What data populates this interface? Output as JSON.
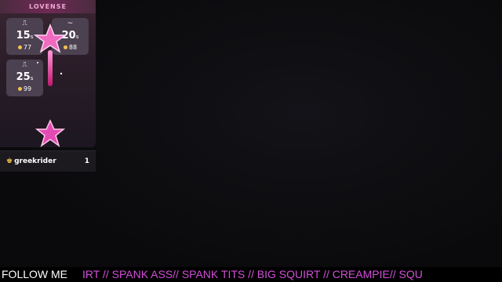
{
  "lovense": {
    "brand": "LOVENSE",
    "levels": [
      {
        "icon": "pulse-low-icon",
        "glyph": "⎍",
        "duration": "15",
        "unit": "s",
        "tokens": "77"
      },
      {
        "icon": "wave-icon",
        "glyph": "∼",
        "duration": "20",
        "unit": "s",
        "tokens": "88"
      },
      {
        "icon": "pulse-high-icon",
        "glyph": "⎍",
        "duration": "25",
        "unit": "s",
        "tokens": "99"
      }
    ]
  },
  "top_tipper": {
    "name": "greekrider",
    "count": "1"
  },
  "ticker": {
    "label": "FOLLOW ME",
    "text": "IRT // SPANK ASS//  SPANK TITS // BIG SQUIRT // CREAMPIE// SQU"
  },
  "colors": {
    "accent": "#d24fd8",
    "coin": "#f6c14b",
    "panel": "#2a1d28"
  }
}
